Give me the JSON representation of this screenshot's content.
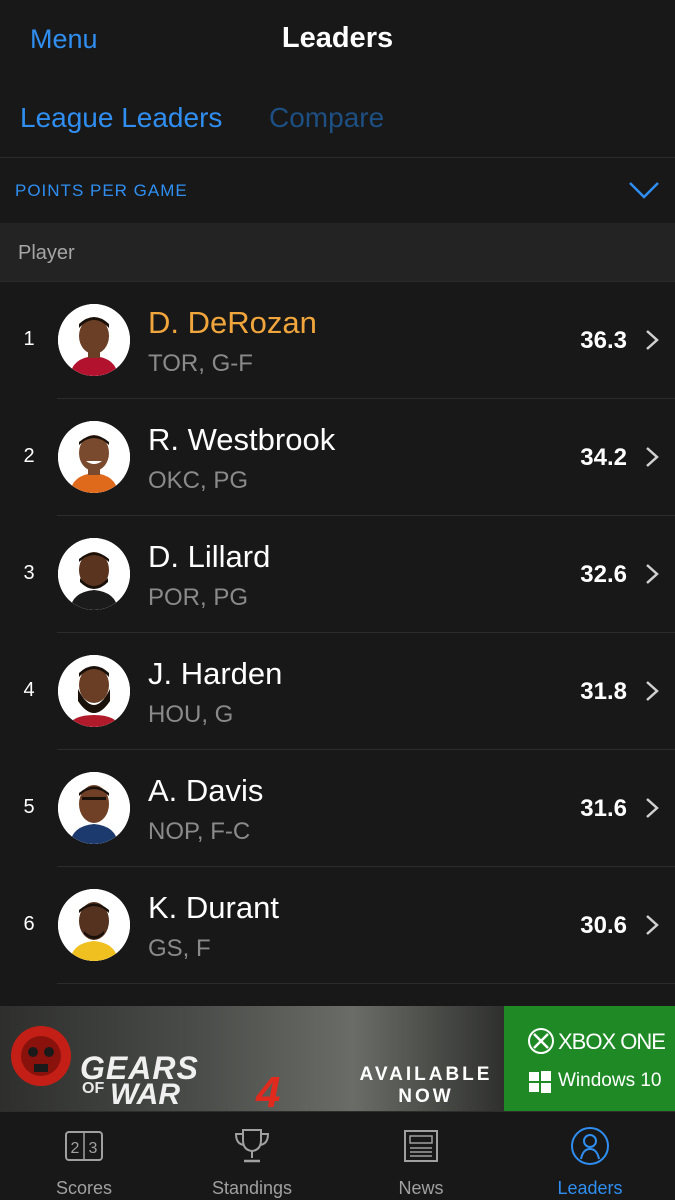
{
  "nav": {
    "menu_label": "Menu",
    "title": "Leaders"
  },
  "tabs": {
    "active": "League Leaders",
    "inactive": "Compare"
  },
  "stat": {
    "label": "POINTS PER GAME",
    "icon": "chevron-down-icon"
  },
  "column_header": "Player",
  "players": [
    {
      "rank": "1",
      "name": "D. DeRozan",
      "meta": "TOR, G-F",
      "value": "36.3",
      "highlight": true
    },
    {
      "rank": "2",
      "name": "R. Westbrook",
      "meta": "OKC, PG",
      "value": "34.2"
    },
    {
      "rank": "3",
      "name": "D. Lillard",
      "meta": "POR, PG",
      "value": "32.6"
    },
    {
      "rank": "4",
      "name": "J. Harden",
      "meta": "HOU, G",
      "value": "31.8"
    },
    {
      "rank": "5",
      "name": "A. Davis",
      "meta": "NOP, F-C",
      "value": "31.6"
    },
    {
      "rank": "6",
      "name": "K. Durant",
      "meta": "GS, F",
      "value": "30.6"
    }
  ],
  "ad": {
    "brand_line1": "GEARS",
    "brand_of": "OF",
    "brand_line2": "WAR",
    "brand_number": "4",
    "availability": "AVAILABLE NOW",
    "platform1": "XBOX ONE",
    "platform2": "Windows 10"
  },
  "tabbar": [
    {
      "label": "Scores",
      "icon": "scoreboard-icon"
    },
    {
      "label": "Standings",
      "icon": "trophy-icon"
    },
    {
      "label": "News",
      "icon": "newspaper-icon"
    },
    {
      "label": "Leaders",
      "icon": "leaders-icon",
      "active": true
    }
  ],
  "colors": {
    "accent": "#2f8ef0",
    "highlight": "#f0a63c",
    "background": "#181818",
    "ad_green": "#1f8a25"
  }
}
